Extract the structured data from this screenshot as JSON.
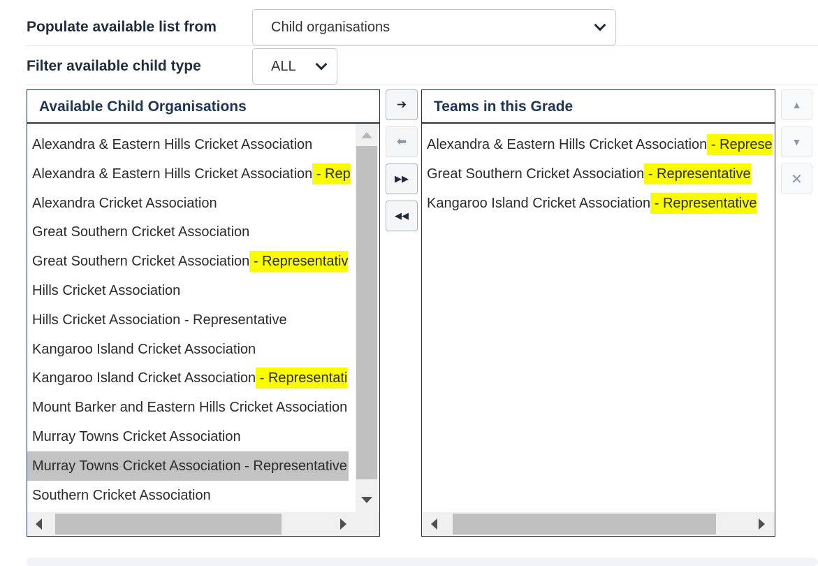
{
  "form": {
    "populate_label": "Populate available list from",
    "populate_value": "Child organisations",
    "filter_label": "Filter available child type",
    "filter_value": "ALL"
  },
  "available": {
    "title": "Available Child Organisations",
    "items": [
      {
        "name": "Alexandra & Eastern Hills Cricket Association",
        "suffix": ""
      },
      {
        "name": "Alexandra & Eastern Hills Cricket Association",
        "suffix": " - Rep"
      },
      {
        "name": "Alexandra Cricket Association",
        "suffix": ""
      },
      {
        "name": "Great Southern Cricket Association",
        "suffix": ""
      },
      {
        "name": "Great Southern Cricket Association",
        "suffix": " - Representativ"
      },
      {
        "name": "Hills Cricket Association",
        "suffix": ""
      },
      {
        "name": "Hills Cricket Association - Representative",
        "suffix": ""
      },
      {
        "name": "Kangaroo Island Cricket Association",
        "suffix": ""
      },
      {
        "name": "Kangaroo Island Cricket Association",
        "suffix": " - Representati"
      },
      {
        "name": "Mount Barker and Eastern Hills Cricket Association",
        "suffix": ""
      },
      {
        "name": "Murray Towns Cricket Association",
        "suffix": ""
      },
      {
        "name": "Murray Towns Cricket Association - Representative",
        "suffix": ""
      },
      {
        "name": "Southern Cricket Association",
        "suffix": ""
      }
    ],
    "selected_index": 11
  },
  "grade": {
    "title": "Teams in this Grade",
    "items": [
      {
        "name": "Alexandra & Eastern Hills Cricket Association",
        "suffix": " - Represe"
      },
      {
        "name": "Great Southern Cricket Association",
        "suffix": " - Representative"
      },
      {
        "name": "Kangaroo Island Cricket Association",
        "suffix": " - Representative"
      }
    ]
  },
  "buttons": {
    "add_icon": "arrow-right-icon",
    "remove_icon": "arrow-left-icon",
    "add_all_icon": "double-arrow-right-icon",
    "remove_all_icon": "double-arrow-left-icon",
    "up_icon": "triangle-up-icon",
    "down_icon": "triangle-down-icon",
    "delete_icon": "close-icon",
    "add_glyph": "➔",
    "remove_glyph": "⬅",
    "add_all_glyph": "▶▶",
    "remove_all_glyph": "◀◀",
    "up_glyph": "▲",
    "down_glyph": "▼",
    "delete_glyph": "✕"
  },
  "colors": {
    "accent": "#1e3556",
    "highlight": "#fbfb00",
    "selected_row": "#c3c3c3"
  }
}
